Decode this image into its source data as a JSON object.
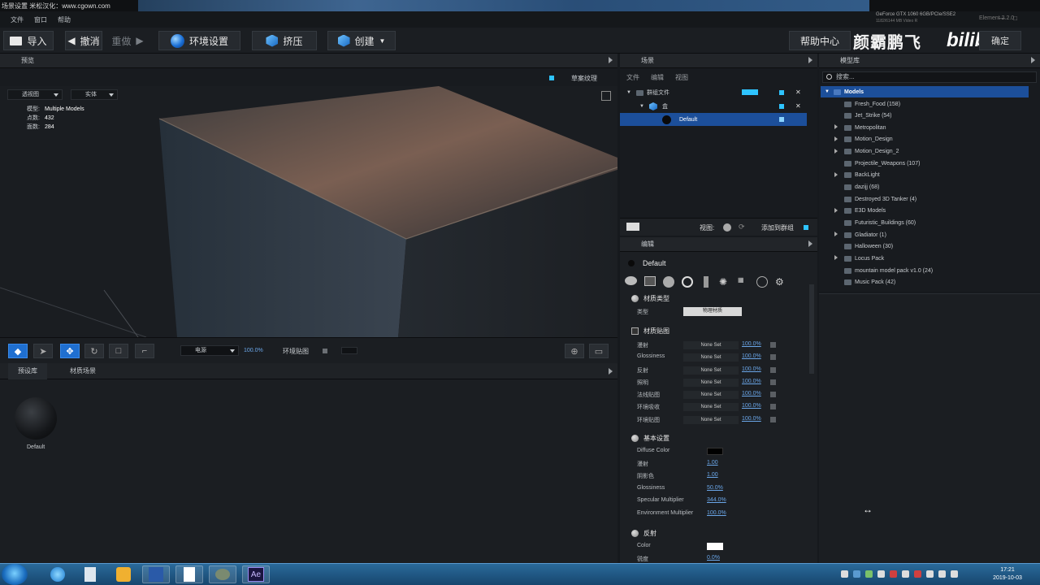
{
  "titlebar": {
    "title": "场景设置  米松汉化：www.cgown.com"
  },
  "menu": [
    "文件",
    "窗口",
    "帮助"
  ],
  "gpu_info": {
    "line1": "GeForce GTX 1060 6GB/PCIe/SSE2",
    "line2": "1182/6144 MB Video R"
  },
  "element_version": "Element  2.2.0",
  "toolbar": {
    "import": "导入",
    "undo": "撤消",
    "redo": "重做",
    "env_setup": "环境设置",
    "extrude": "挤压",
    "create": "创建",
    "help_center": "帮助中心",
    "confirm": "确定"
  },
  "watermark": {
    "text": "颜霸鹏飞",
    "logo": "bilibili"
  },
  "viewport": {
    "header": "预览",
    "texture_checkbox_label": "草案纹理",
    "view_mode": "透视图",
    "shading_mode": "实体",
    "info": [
      {
        "label": "模型:",
        "value": "Multiple Models"
      },
      {
        "label": "点数:",
        "value": "432"
      },
      {
        "label": "面数:",
        "value": "284"
      }
    ],
    "bar": {
      "light_select": "电源",
      "zoom": "100.0%",
      "env_map": "环境贴图"
    }
  },
  "library": {
    "tabs": [
      "预设库",
      "材质场景"
    ],
    "items": [
      {
        "name": "Default"
      }
    ]
  },
  "scene": {
    "header": "场景",
    "menu": [
      "文件",
      "编辑",
      "视图"
    ],
    "rows": [
      {
        "label": "群组文件",
        "level": 0
      },
      {
        "label": "盒",
        "level": 1
      },
      {
        "label": "Default",
        "level": 2
      }
    ],
    "footer": {
      "view_label": "视图:",
      "add_group": "添加到群组"
    }
  },
  "edit": {
    "header": "编辑",
    "material_name": "Default",
    "sections": {
      "material_type": "材质类型",
      "material_maps": "材质贴图",
      "basic": "基本设置",
      "reflection": "反射"
    },
    "type_label": "类型",
    "type_value": "物理材质",
    "maps": [
      {
        "name": "漫射",
        "value": "None Set",
        "pct": "100.0%"
      },
      {
        "name": "Glossiness",
        "value": "None Set",
        "pct": "100.0%"
      },
      {
        "name": "反射",
        "value": "None Set",
        "pct": "100.0%"
      },
      {
        "name": "照明",
        "value": "None Set",
        "pct": "100.0%"
      },
      {
        "name": "法线贴图",
        "value": "None Set",
        "pct": "100.0%"
      },
      {
        "name": "环境吸收",
        "value": "None Set",
        "pct": "100.0%"
      },
      {
        "name": "环境贴图",
        "value": "None Set",
        "pct": "100.0%"
      }
    ],
    "basic": [
      {
        "name": "Diffuse Color",
        "color": "#000000"
      },
      {
        "name": "漫射",
        "value": "1.00"
      },
      {
        "name": "阴影色",
        "value": "1.00"
      },
      {
        "name": "Glossiness",
        "value": "50.0%"
      },
      {
        "name": "Specular Multiplier",
        "value": "344.0%"
      },
      {
        "name": "Environment Multiplier",
        "value": "100.0%"
      }
    ],
    "reflection": [
      {
        "name": "Color",
        "color": "#ffffff"
      },
      {
        "name": "锐度",
        "value": "0.0%"
      }
    ]
  },
  "models": {
    "header": "模型库",
    "search_placeholder": "搜索...",
    "root": "Models",
    "items": [
      {
        "name": "Fresh_Food (158)",
        "expandable": false
      },
      {
        "name": "Jet_Strike (54)",
        "expandable": false
      },
      {
        "name": "Metropolitan",
        "expandable": true
      },
      {
        "name": "Motion_Design",
        "expandable": true
      },
      {
        "name": "Motion_Design_2",
        "expandable": true
      },
      {
        "name": "Projectile_Weapons (107)",
        "expandable": false
      },
      {
        "name": "BackLight",
        "expandable": true
      },
      {
        "name": "dazijj (68)",
        "expandable": false
      },
      {
        "name": "Destroyed 3D Tanker (4)",
        "expandable": false
      },
      {
        "name": "E3D Models",
        "expandable": true
      },
      {
        "name": "Futuristic_Buildings (60)",
        "expandable": false
      },
      {
        "name": "Gladiator (1)",
        "expandable": true
      },
      {
        "name": "Halloween (30)",
        "expandable": false
      },
      {
        "name": "Locus Pack",
        "expandable": true
      },
      {
        "name": "mountain model pack v1.0 (24)",
        "expandable": false
      },
      {
        "name": "Music Pack (42)",
        "expandable": false
      }
    ]
  },
  "taskbar": {
    "apps": [
      "ie-icon",
      "explorer-icon",
      "store-icon",
      "word-icon",
      "notepad-icon",
      "tools-icon",
      "ae-icon"
    ],
    "ae_label": "Ae",
    "time": "17:21",
    "date": "2019-10-03"
  },
  "colors": {
    "accent": "#2ec4ff",
    "selection": "#1c4f9a",
    "link": "#6aa6e8"
  }
}
